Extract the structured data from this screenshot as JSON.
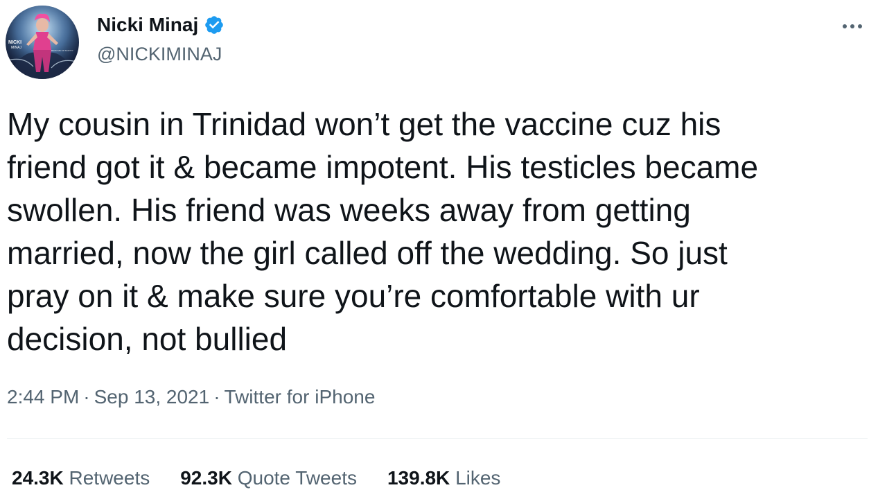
{
  "user": {
    "display_name": "Nicki Minaj",
    "handle": "@NICKIMINAJ",
    "verified": true,
    "avatar": {
      "icon": "profile-photo",
      "logo_text": "NICKI MINAJ",
      "caption_text": "BEAM ME UP SCOTTY"
    }
  },
  "tweet": {
    "text": "My cousin in Trinidad won’t get the vaccine cuz his\nfriend got it & became impotent. His testicles became\nswollen. His friend was weeks away from getting\nmarried, now the girl called off the wedding. So just\npray on it & make sure you’re comfortable with ur\ndecision, not bullied",
    "time": "2:44 PM",
    "date": "Sep 13, 2021",
    "source": "Twitter for iPhone",
    "separator": "·"
  },
  "stats": {
    "retweets": {
      "count": "24.3K",
      "label": "Retweets"
    },
    "quote_tweets": {
      "count": "92.3K",
      "label": "Quote Tweets"
    },
    "likes": {
      "count": "139.8K",
      "label": "Likes"
    }
  },
  "icons": {
    "verified": "verified-badge-icon",
    "more": "more-options-icon"
  },
  "colors": {
    "text_primary": "#0f1419",
    "text_secondary": "#536471",
    "verified_blue": "#1d9bf0",
    "divider": "#eff3f4"
  }
}
